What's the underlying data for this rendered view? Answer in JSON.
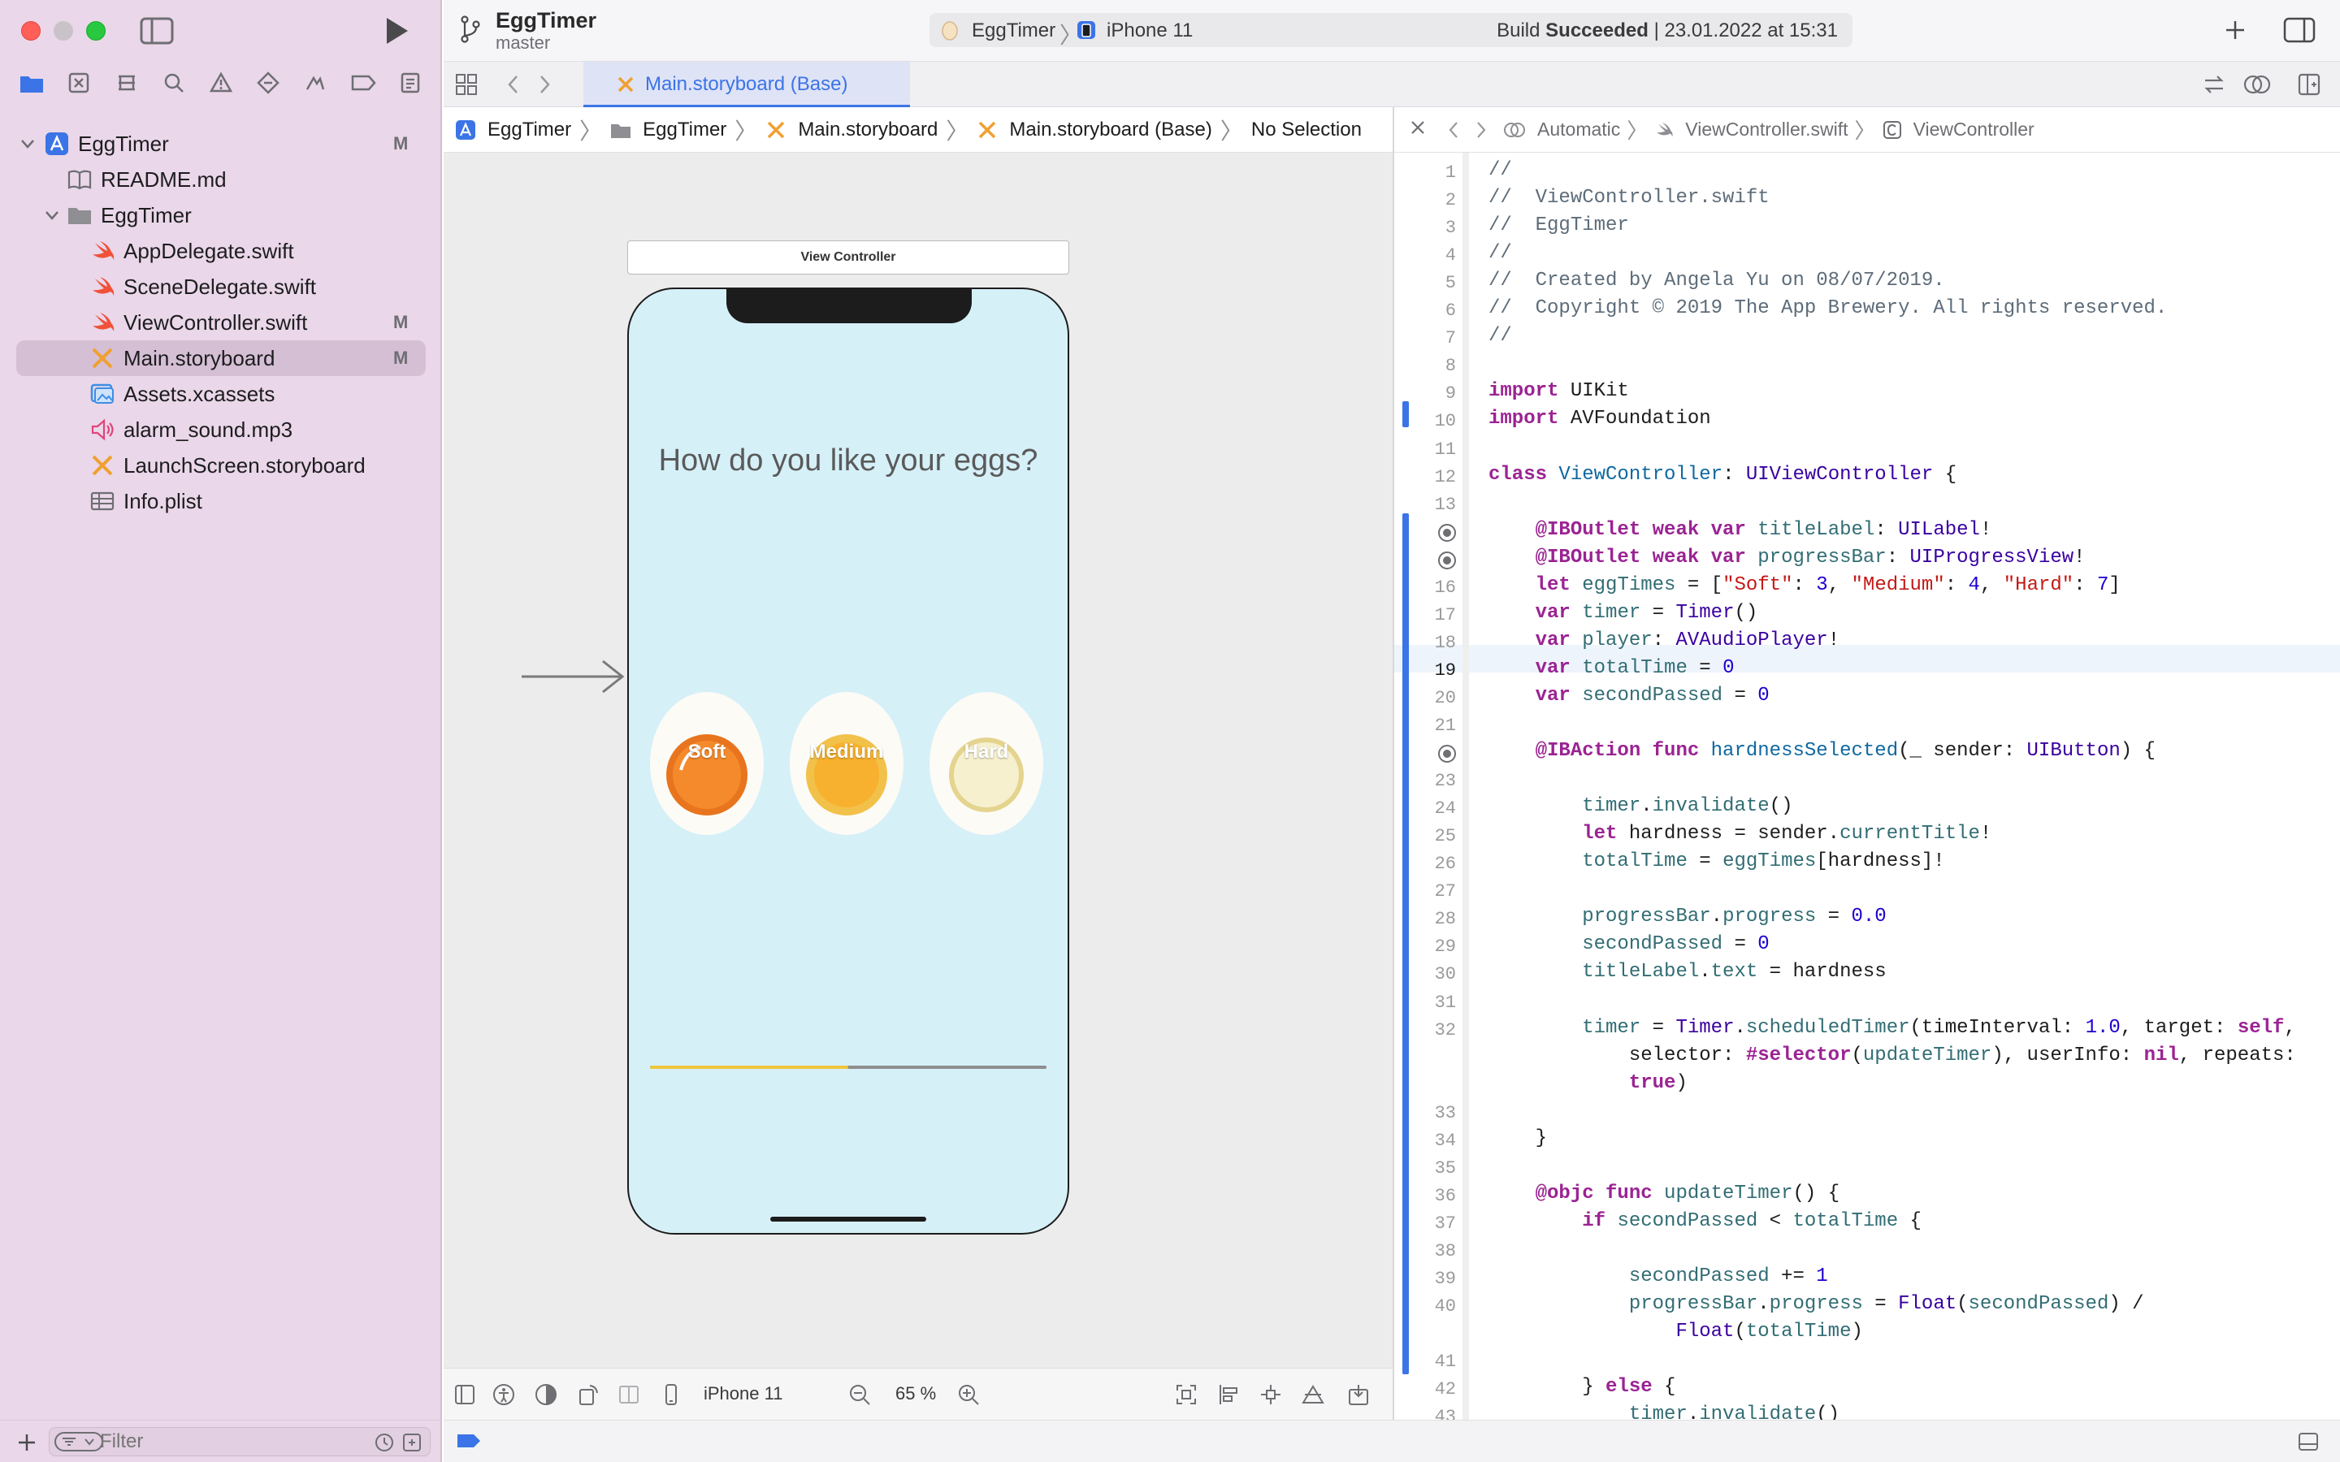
{
  "window": {
    "project_title": "EggTimer",
    "branch": "master",
    "scheme_target": "EggTimer",
    "scheme_device": "iPhone 11",
    "build_status_word": "Build",
    "build_status_result": "Succeeded",
    "build_status_time": "| 23.01.2022 at 15:31"
  },
  "navigator": {
    "items": [
      {
        "label": "EggTimer",
        "status": "M",
        "icon": "xcode-project-icon"
      },
      {
        "label": "README.md",
        "status": "",
        "icon": "book-icon"
      },
      {
        "label": "EggTimer",
        "status": "",
        "icon": "folder-icon"
      },
      {
        "label": "AppDelegate.swift",
        "status": "",
        "icon": "swift-icon"
      },
      {
        "label": "SceneDelegate.swift",
        "status": "",
        "icon": "swift-icon"
      },
      {
        "label": "ViewController.swift",
        "status": "M",
        "icon": "swift-icon"
      },
      {
        "label": "Main.storyboard",
        "status": "M",
        "icon": "storyboard-icon"
      },
      {
        "label": "Assets.xcassets",
        "status": "",
        "icon": "assets-icon"
      },
      {
        "label": "alarm_sound.mp3",
        "status": "",
        "icon": "audio-icon"
      },
      {
        "label": "LaunchScreen.storyboard",
        "status": "",
        "icon": "storyboard-icon"
      },
      {
        "label": "Info.plist",
        "status": "",
        "icon": "table-icon"
      }
    ],
    "filter_placeholder": "Filter"
  },
  "tabs": [
    {
      "label": "Main.storyboard (Base)",
      "active": true
    }
  ],
  "canvas": {
    "breadcrumb": [
      "EggTimer",
      "EggTimer",
      "Main.storyboard",
      "Main.storyboard (Base)",
      "No Selection"
    ],
    "scene_title": "View Controller",
    "phone_title": "How do you like your eggs?",
    "egg_buttons": [
      "Soft",
      "Medium",
      "Hard"
    ],
    "progress": 0.5,
    "device": "iPhone 11",
    "zoom": "65 %"
  },
  "code_editor": {
    "breadcrumb": [
      "Automatic",
      "ViewController.swift",
      "ViewController"
    ],
    "current_line": 19,
    "lines": [
      {
        "n": "1",
        "t": "//"
      },
      {
        "n": "2",
        "t": "//  ViewController.swift"
      },
      {
        "n": "3",
        "t": "//  EggTimer"
      },
      {
        "n": "4",
        "t": "//"
      },
      {
        "n": "5",
        "t": "//  Created by Angela Yu on 08/07/2019."
      },
      {
        "n": "6",
        "t": "//  Copyright © 2019 The App Brewery. All rights reserved."
      },
      {
        "n": "7",
        "t": "//"
      },
      {
        "n": "8",
        "t": ""
      },
      {
        "n": "9",
        "t": "import UIKit"
      },
      {
        "n": "10",
        "t": "import AVFoundation"
      },
      {
        "n": "11",
        "t": ""
      },
      {
        "n": "12",
        "t": "class ViewController: UIViewController {"
      },
      {
        "n": "13",
        "t": ""
      },
      {
        "n": "",
        "t": "    @IBOutlet weak var titleLabel: UILabel!"
      },
      {
        "n": "",
        "t": "    @IBOutlet weak var progressBar: UIProgressView!"
      },
      {
        "n": "16",
        "t": "    let eggTimes = [\"Soft\": 3, \"Medium\": 4, \"Hard\": 7]"
      },
      {
        "n": "17",
        "t": "    var timer = Timer()"
      },
      {
        "n": "18",
        "t": "    var player: AVAudioPlayer!"
      },
      {
        "n": "19",
        "t": "    var totalTime = 0"
      },
      {
        "n": "20",
        "t": "    var secondPassed = 0"
      },
      {
        "n": "21",
        "t": ""
      },
      {
        "n": "",
        "t": "    @IBAction func hardnessSelected(_ sender: UIButton) {"
      },
      {
        "n": "23",
        "t": ""
      },
      {
        "n": "24",
        "t": "        timer.invalidate()"
      },
      {
        "n": "25",
        "t": "        let hardness = sender.currentTitle!"
      },
      {
        "n": "26",
        "t": "        totalTime = eggTimes[hardness]!"
      },
      {
        "n": "27",
        "t": ""
      },
      {
        "n": "28",
        "t": "        progressBar.progress = 0.0"
      },
      {
        "n": "29",
        "t": "        secondPassed = 0"
      },
      {
        "n": "30",
        "t": "        titleLabel.text = hardness"
      },
      {
        "n": "31",
        "t": ""
      },
      {
        "n": "32",
        "t": "        timer = Timer.scheduledTimer(timeInterval: 1.0, target: self,"
      },
      {
        "n": "",
        "t": "            selector: #selector(updateTimer), userInfo: nil, repeats:"
      },
      {
        "n": "",
        "t": "            true)"
      },
      {
        "n": "33",
        "t": ""
      },
      {
        "n": "34",
        "t": "    }"
      },
      {
        "n": "35",
        "t": ""
      },
      {
        "n": "36",
        "t": "    @objc func updateTimer() {"
      },
      {
        "n": "37",
        "t": "        if secondPassed < totalTime {"
      },
      {
        "n": "38",
        "t": ""
      },
      {
        "n": "39",
        "t": "            secondPassed += 1"
      },
      {
        "n": "40",
        "t": "            progressBar.progress = Float(secondPassed) /"
      },
      {
        "n": "",
        "t": "                Float(totalTime)"
      },
      {
        "n": "41",
        "t": ""
      },
      {
        "n": "42",
        "t": "        } else {"
      },
      {
        "n": "43",
        "t": "            timer.invalidate()"
      }
    ],
    "breakpoint_lines": [
      14,
      15,
      22
    ]
  },
  "colors": {
    "accent": "#3b74e6",
    "sidebar_bg": "#ead7e9",
    "phone_bg": "#d6f0f8",
    "progress_fill": "#f0c53c"
  }
}
